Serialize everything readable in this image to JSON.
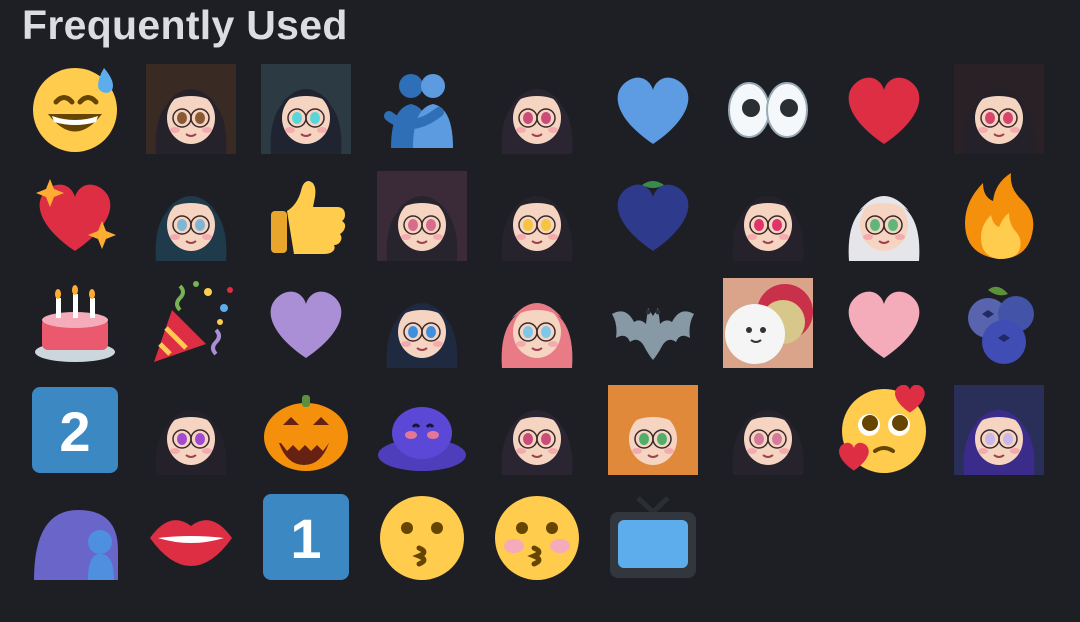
{
  "section": {
    "title": "Frequently Used"
  },
  "emojis": [
    {
      "name": "grinning-face-with-sweat-icon",
      "type": "sweat_smile"
    },
    {
      "name": "custom-emoji-gift-icon",
      "type": "portrait",
      "hair": "#26222b",
      "bg": "#3a2a24",
      "accent": "#8a5a36"
    },
    {
      "name": "custom-emoji-sparkle-laugh-icon",
      "type": "portrait",
      "hair": "#1f2430",
      "bg": "#2c3a44",
      "accent": "#58d6d9"
    },
    {
      "name": "people-hugging-icon",
      "type": "hug"
    },
    {
      "name": "custom-emoji-peek-icon",
      "type": "portrait",
      "hair": "#2a2530",
      "bg": "#1e1f25",
      "accent": "#c94c7a"
    },
    {
      "name": "blue-heart-icon",
      "type": "heart",
      "color": "#5d9be3"
    },
    {
      "name": "eyes-icon",
      "type": "eyes"
    },
    {
      "name": "red-heart-icon",
      "type": "heart",
      "color": "#dd2e44"
    },
    {
      "name": "custom-emoji-blush-icon",
      "type": "portrait",
      "hair": "#24212a",
      "bg": "#2a2127",
      "accent": "#d6456b"
    },
    {
      "name": "sparkling-heart-icon",
      "type": "sparkle_heart"
    },
    {
      "name": "custom-emoji-wink-icon",
      "type": "portrait",
      "hair": "#1f3a4a",
      "bg": "#1e1f25",
      "accent": "#7fb6d6"
    },
    {
      "name": "thumbs-up-icon",
      "type": "thumbs"
    },
    {
      "name": "custom-emoji-glasses-icon",
      "type": "portrait",
      "hair": "#28242e",
      "bg": "#3b2b38",
      "accent": "#d86c8c"
    },
    {
      "name": "custom-emoji-starstruck-icon",
      "type": "portrait",
      "hair": "#27232d",
      "bg": "#1e1f25",
      "accent": "#f5c542"
    },
    {
      "name": "custom-emoji-blueberry-heart-icon",
      "type": "heart",
      "color": "#2e3a8c",
      "leaf": true
    },
    {
      "name": "custom-emoji-heart-kiss-icon",
      "type": "portrait",
      "hair": "#26222b",
      "bg": "#1e1f25",
      "accent": "#e0336a"
    },
    {
      "name": "custom-emoji-white-hair-grin-icon",
      "type": "portrait",
      "hair": "#e6e6ea",
      "bg": "#1e1f25",
      "accent": "#5fb57a"
    },
    {
      "name": "fire-icon",
      "type": "fire"
    },
    {
      "name": "birthday-cake-icon",
      "type": "cake"
    },
    {
      "name": "party-popper-icon",
      "type": "party"
    },
    {
      "name": "purple-heart-icon",
      "type": "heart",
      "color": "#aa8ed6"
    },
    {
      "name": "custom-emoji-blue-heart-hug-icon",
      "type": "portrait",
      "hair": "#1f2a40",
      "bg": "#1e1f25",
      "accent": "#3f8fe0"
    },
    {
      "name": "custom-emoji-pink-hair-icon",
      "type": "portrait",
      "hair": "#e87b86",
      "bg": "#1e1f25",
      "accent": "#7fc7e8"
    },
    {
      "name": "bat-icon",
      "type": "bat"
    },
    {
      "name": "custom-emoji-cuddle-icon",
      "type": "cuddle"
    },
    {
      "name": "pink-heart-icon",
      "type": "heart",
      "color": "#f4abba"
    },
    {
      "name": "blueberries-icon",
      "type": "blueberries"
    },
    {
      "name": "keycap-2-icon",
      "type": "keycap",
      "label": "2"
    },
    {
      "name": "custom-emoji-smirk-icon",
      "type": "portrait",
      "hair": "#25212b",
      "bg": "#1e1f25",
      "accent": "#a04bd0"
    },
    {
      "name": "jack-o-lantern-icon",
      "type": "pumpkin"
    },
    {
      "name": "custom-emoji-blob-blush-icon",
      "type": "blob"
    },
    {
      "name": "custom-emoji-peek-2-icon",
      "type": "portrait",
      "hair": "#2a2530",
      "bg": "#1e1f25",
      "accent": "#c94c7a"
    },
    {
      "name": "custom-emoji-ginger-icon",
      "type": "portrait",
      "hair": "#e0893a",
      "bg": "#e0893a",
      "accent": "#4fae6a"
    },
    {
      "name": "custom-emoji-teary-icon",
      "type": "portrait",
      "hair": "#27232d",
      "bg": "#1e1f25",
      "accent": "#d47a9a"
    },
    {
      "name": "face-holding-back-tears-hearts-icon",
      "type": "pleading_hearts"
    },
    {
      "name": "custom-emoji-purple-hair-glasses-icon",
      "type": "portrait",
      "hair": "#3b2c8c",
      "bg": "#2a2f5a",
      "accent": "#c9b8e8"
    },
    {
      "name": "custom-emoji-purple-blob-icon",
      "type": "purple_blob"
    },
    {
      "name": "biting-lip-icon",
      "type": "lips"
    },
    {
      "name": "keycap-1-icon",
      "type": "keycap",
      "label": "1"
    },
    {
      "name": "kissing-face-icon",
      "type": "kiss",
      "blush": false
    },
    {
      "name": "kissing-face-closed-eyes-icon",
      "type": "kiss",
      "blush": true
    },
    {
      "name": "television-icon",
      "type": "tv"
    }
  ],
  "colors": {
    "background": "#1e1f25",
    "title": "#dcdde2",
    "emoji_yellow": "#ffcc4d",
    "keycap_blue": "#3b88c3"
  }
}
